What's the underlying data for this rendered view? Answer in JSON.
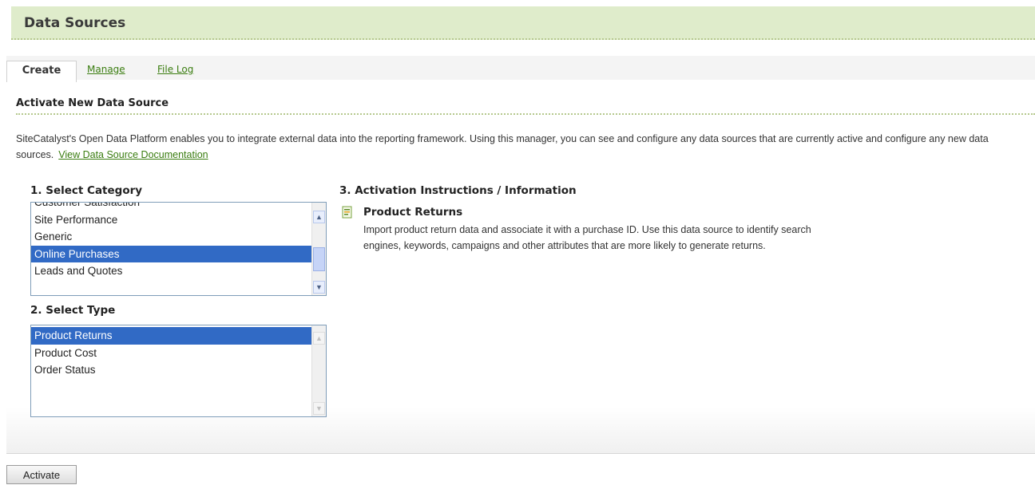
{
  "header": {
    "title": "Data Sources"
  },
  "tabs": {
    "create": "Create",
    "manage": "Manage",
    "file_log": "File Log"
  },
  "section": {
    "title": "Activate New Data Source"
  },
  "description": {
    "text": "SiteCatalyst's Open Data Platform enables you to integrate external data into the reporting framework. Using this manager, you can see and configure any data sources that are currently active and configure any new data sources.",
    "link": "View Data Source Documentation"
  },
  "category": {
    "label": "1. Select Category",
    "items": [
      "Customer Satisfaction",
      "Site Performance",
      "Generic",
      "Online Purchases",
      "Leads and Quotes"
    ],
    "selected": "Online Purchases"
  },
  "type": {
    "label": "2. Select Type",
    "items": [
      "Product Returns",
      "Product Cost",
      "Order Status"
    ],
    "selected": "Product Returns"
  },
  "info": {
    "label": "3. Activation Instructions / Information",
    "title": "Product Returns",
    "text": "Import product return data and associate it with a purchase ID. Use this data source to identify search engines, keywords, campaigns and other attributes that are more likely to generate returns."
  },
  "actions": {
    "activate": "Activate"
  },
  "colors": {
    "header_bg": "#dfeccb",
    "link": "#3a7d10",
    "selection": "#316ac5"
  }
}
